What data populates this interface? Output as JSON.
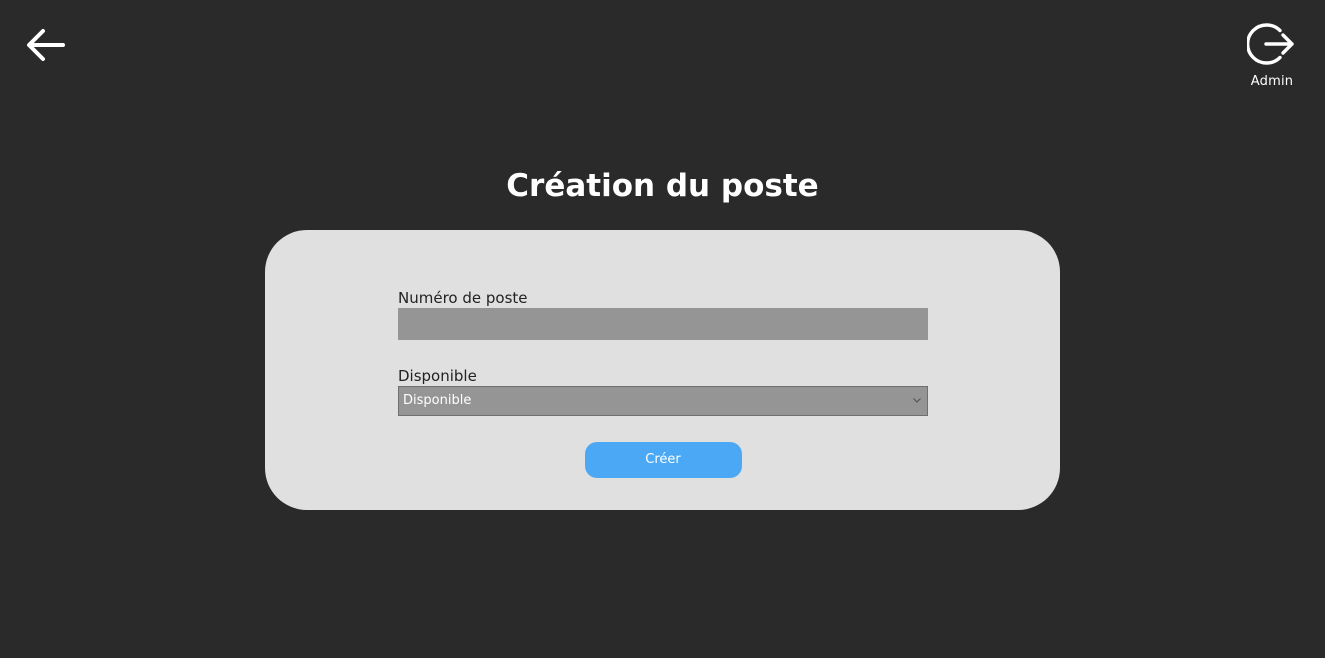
{
  "header": {
    "back_icon": "arrow-left-icon",
    "logout_icon": "logout-icon",
    "user_label": "Admin"
  },
  "page": {
    "title": "Création du poste"
  },
  "form": {
    "number_field": {
      "label": "Numéro de poste",
      "value": "",
      "placeholder": ""
    },
    "available_field": {
      "label": "Disponible",
      "selected": "Disponible"
    },
    "submit_label": "Créer"
  },
  "colors": {
    "background": "#2a2a2a",
    "card": "#e0e0e0",
    "input": "#959595",
    "accent": "#4aa8f5"
  }
}
